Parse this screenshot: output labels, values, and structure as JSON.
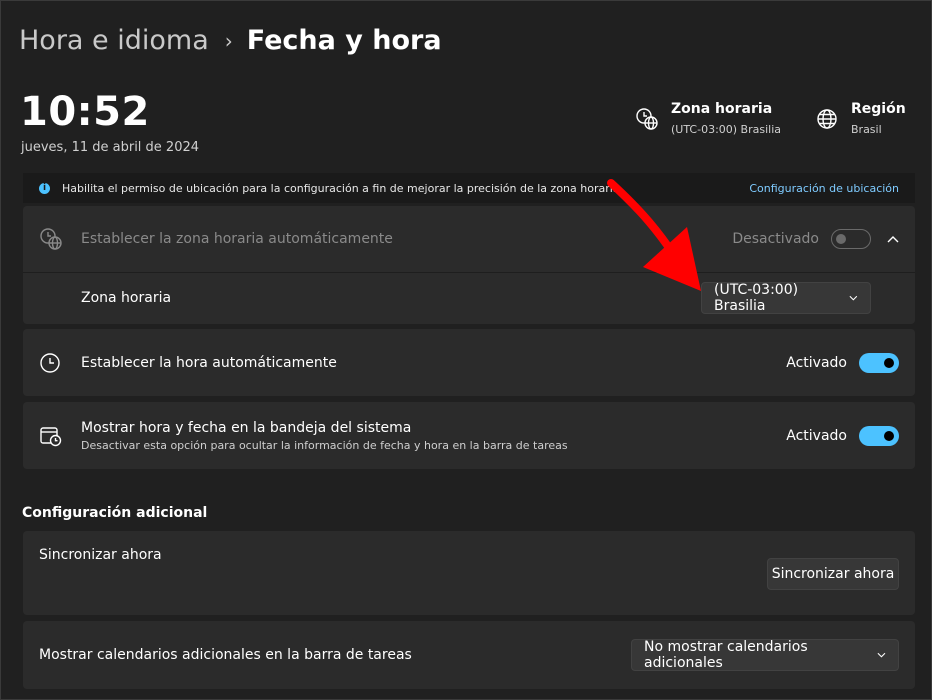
{
  "breadcrumb": {
    "parent": "Hora e idioma",
    "separator": "›",
    "current": "Fecha y hora"
  },
  "clock": {
    "time": "10:52",
    "date": "jueves, 11 de abril de 2024"
  },
  "header_info": {
    "timezone": {
      "title": "Zona horaria",
      "value": "(UTC-03:00) Brasilia",
      "icon": "clock-globe-icon"
    },
    "region": {
      "title": "Región",
      "value": "Brasil",
      "icon": "globe-icon"
    }
  },
  "banner": {
    "icon": "info-icon",
    "icon_glyph": "i",
    "message": "Habilita el permiso de ubicación para la configuración a fin de mejorar la precisión de la zona horaria.",
    "link": "Configuración de ubicación"
  },
  "auto_timezone": {
    "label": "Establecer la zona horaria automáticamente",
    "state": "Desactivado",
    "enabled": false
  },
  "timezone_row": {
    "label": "Zona horaria",
    "selected": "(UTC-03:00) Brasilia"
  },
  "auto_time": {
    "label": "Establecer la hora automáticamente",
    "state": "Activado",
    "enabled": true
  },
  "tray": {
    "label": "Mostrar hora y fecha en la bandeja del sistema",
    "description": "Desactivar esta opción para ocultar la información de fecha y hora en la barra de tareas",
    "state": "Activado",
    "enabled": true
  },
  "additional": {
    "title": "Configuración adicional",
    "sync": {
      "label": "Sincronizar ahora",
      "button": "Sincronizar ahora"
    },
    "calendars": {
      "label": "Mostrar calendarios adicionales en la barra de tareas",
      "selected": "No mostrar calendarios adicionales"
    }
  },
  "colors": {
    "accent": "#4cc2ff",
    "background": "#202020",
    "card": "#2b2b2b",
    "annotation_arrow": "#ff0000"
  }
}
